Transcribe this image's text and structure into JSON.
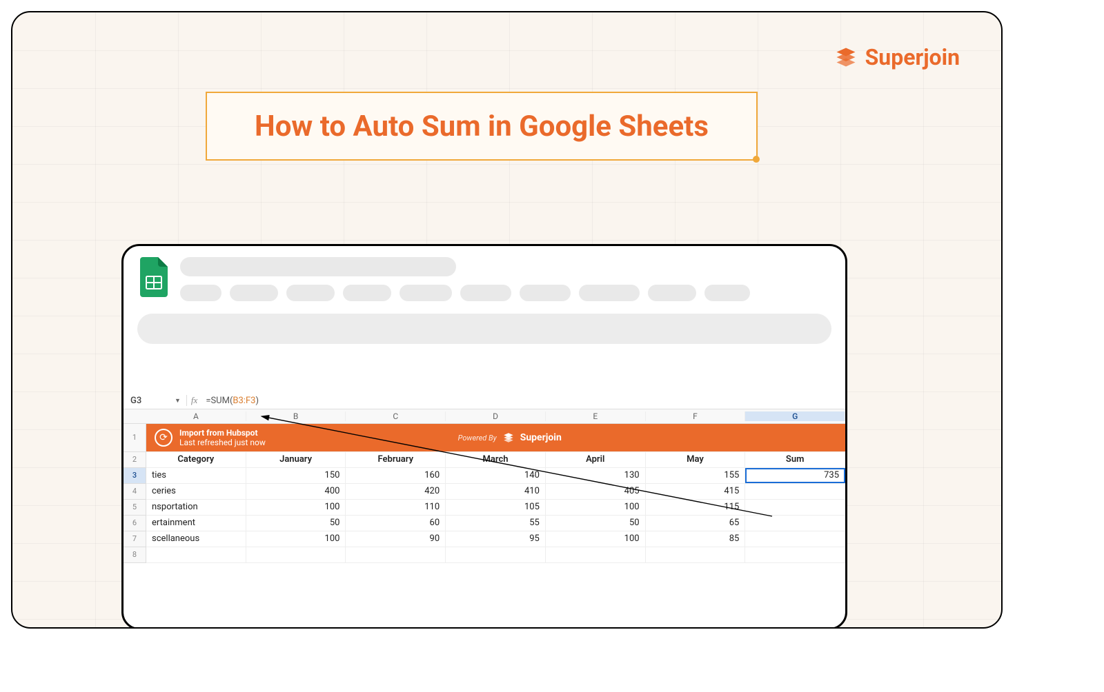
{
  "brand": {
    "name": "Superjoin"
  },
  "title": "How to Auto Sum in Google Sheets",
  "formula_bar": {
    "name_box": "G3",
    "fx_label": "fx",
    "formula_prefix": "=SUM(",
    "formula_range": "B3:F3",
    "formula_suffix": ")"
  },
  "columns": [
    "A",
    "B",
    "C",
    "D",
    "E",
    "F",
    "G"
  ],
  "selected_column_index": 6,
  "selected_row_number": 3,
  "banner": {
    "title": "Import from Hubspot",
    "subtitle": "Last refreshed just now",
    "powered_by_label": "Powered By",
    "powered_by_brand": "Superjoin"
  },
  "headers_row": [
    "Category",
    "January",
    "February",
    "March",
    "April",
    "May",
    "Sum"
  ],
  "data_rows": [
    {
      "n": 3,
      "cells": [
        "ties",
        "150",
        "160",
        "140",
        "130",
        "155",
        "735"
      ]
    },
    {
      "n": 4,
      "cells": [
        "ceries",
        "400",
        "420",
        "410",
        "405",
        "415",
        ""
      ]
    },
    {
      "n": 5,
      "cells": [
        "nsportation",
        "100",
        "110",
        "105",
        "100",
        "115",
        ""
      ]
    },
    {
      "n": 6,
      "cells": [
        "ertainment",
        "50",
        "60",
        "55",
        "50",
        "65",
        ""
      ]
    },
    {
      "n": 7,
      "cells": [
        "scellaneous",
        "100",
        "90",
        "95",
        "100",
        "85",
        ""
      ]
    },
    {
      "n": 8,
      "cells": [
        "",
        "",
        "",
        "",
        "",
        "",
        ""
      ]
    }
  ],
  "skeleton_menu_widths": [
    60,
    70,
    70,
    70,
    76,
    74,
    74,
    88,
    70,
    66
  ],
  "selected_cell": {
    "row": 3,
    "col": 6
  }
}
